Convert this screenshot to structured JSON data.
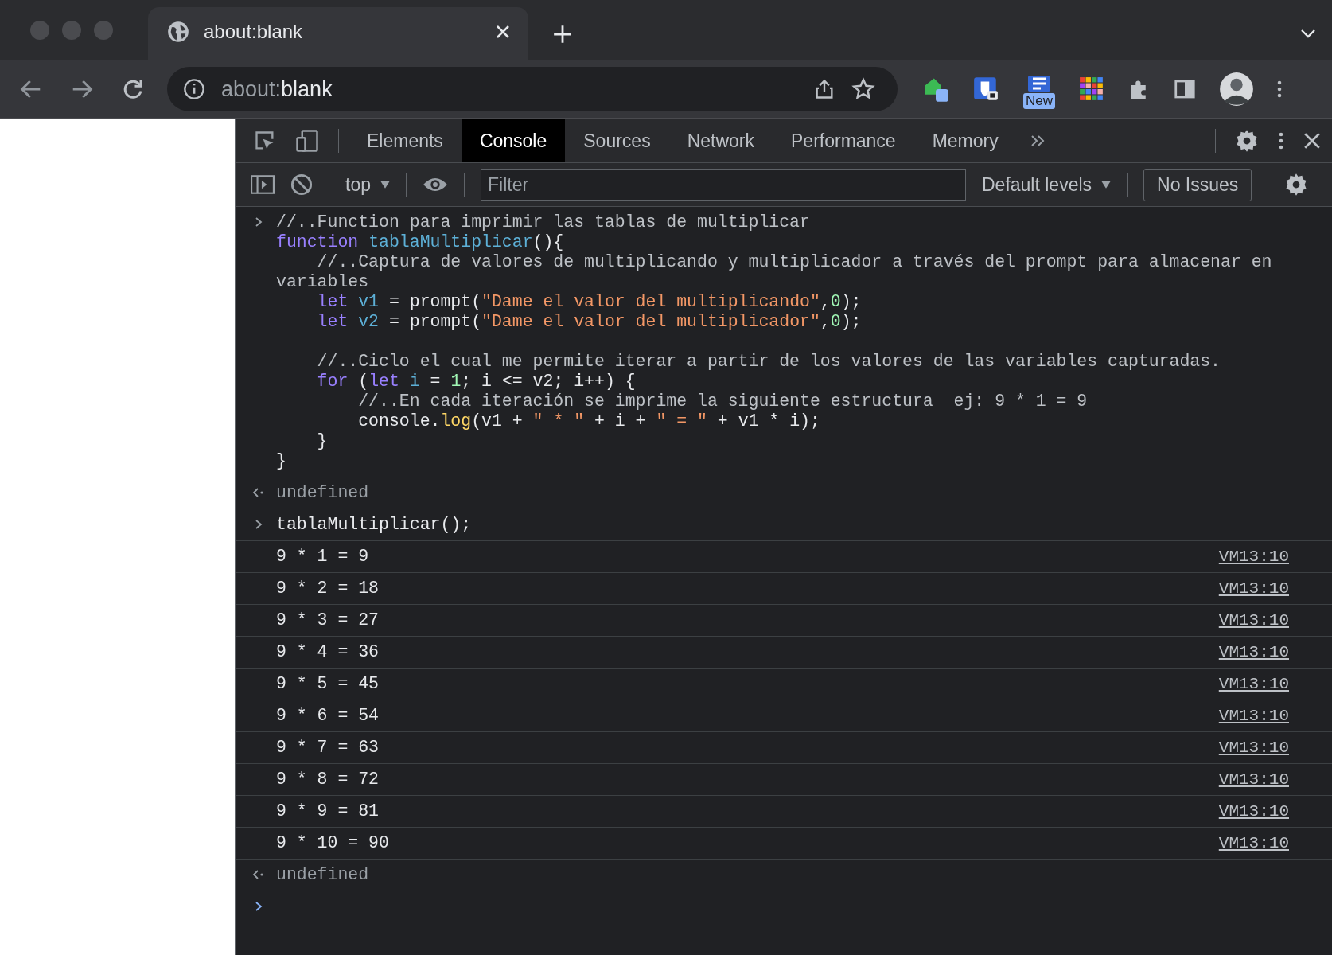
{
  "tabs": [
    {
      "title": "about:blank",
      "selected": true
    }
  ],
  "address_bar": {
    "scheme": "about:",
    "rest": "blank"
  },
  "extensions": [
    {
      "kind": "green"
    },
    {
      "kind": "shield"
    },
    {
      "kind": "new",
      "badge": "New"
    },
    {
      "kind": "grid"
    },
    {
      "kind": "puzzle"
    },
    {
      "kind": "panel"
    },
    {
      "kind": "avatar"
    }
  ],
  "devtools": {
    "tabs": [
      {
        "label": "Elements",
        "selected": false
      },
      {
        "label": "Console",
        "selected": true
      },
      {
        "label": "Sources",
        "selected": false
      },
      {
        "label": "Network",
        "selected": false
      },
      {
        "label": "Performance",
        "selected": false
      },
      {
        "label": "Memory",
        "selected": false
      }
    ],
    "context": "top",
    "filter": {
      "placeholder": "Filter"
    },
    "levels": "Default levels",
    "issues": "No Issues"
  },
  "console": [
    {
      "kind": "input",
      "lines": [
        {
          "kind": "code",
          "tokens": [
            {
              "kind": "comment",
              "text": "//..Function para imprimir las tablas de multiplicar"
            }
          ]
        },
        {
          "kind": "code",
          "tokens": [
            {
              "kind": "keyword",
              "text": "function "
            },
            {
              "kind": "def",
              "text": "tablaMultiplicar"
            },
            {
              "kind": "plain",
              "text": "(){"
            }
          ]
        },
        {
          "kind": "code",
          "tokens": [
            {
              "kind": "comment",
              "text": "    //..Captura de valores de multiplicando y multiplicador a través del prompt para almacenar en variables"
            }
          ]
        },
        {
          "kind": "code",
          "tokens": [
            {
              "kind": "keyword",
              "text": "    let "
            },
            {
              "kind": "def",
              "text": "v1"
            },
            {
              "kind": "plain",
              "text": " = prompt("
            },
            {
              "kind": "string",
              "text": "\"Dame el valor del multiplicando\""
            },
            {
              "kind": "plain",
              "text": ","
            },
            {
              "kind": "number",
              "text": "0"
            },
            {
              "kind": "plain",
              "text": ");"
            }
          ]
        },
        {
          "kind": "code",
          "tokens": [
            {
              "kind": "keyword",
              "text": "    let "
            },
            {
              "kind": "def",
              "text": "v2"
            },
            {
              "kind": "plain",
              "text": " = prompt("
            },
            {
              "kind": "string",
              "text": "\"Dame el valor del multiplicador\""
            },
            {
              "kind": "plain",
              "text": ","
            },
            {
              "kind": "number",
              "text": "0"
            },
            {
              "kind": "plain",
              "text": ");"
            }
          ]
        },
        {
          "kind": "blank"
        },
        {
          "kind": "code",
          "tokens": [
            {
              "kind": "comment",
              "text": "    //..Ciclo el cual me permite iterar a partir de los valores de las variables capturadas."
            }
          ]
        },
        {
          "kind": "code",
          "tokens": [
            {
              "kind": "keyword",
              "text": "    for"
            },
            {
              "kind": "plain",
              "text": " ("
            },
            {
              "kind": "keyword",
              "text": "let "
            },
            {
              "kind": "def",
              "text": "i"
            },
            {
              "kind": "plain",
              "text": " = "
            },
            {
              "kind": "number",
              "text": "1"
            },
            {
              "kind": "plain",
              "text": "; i <= v2; i++) {"
            }
          ]
        },
        {
          "kind": "code",
          "tokens": [
            {
              "kind": "comment",
              "text": "        //..En cada iteración se imprime la siguiente estructura  ej: 9 * 1 = 9"
            }
          ]
        },
        {
          "kind": "code",
          "tokens": [
            {
              "kind": "plain",
              "text": "        console."
            },
            {
              "kind": "method",
              "text": "log"
            },
            {
              "kind": "plain",
              "text": "(v1 + "
            },
            {
              "kind": "string",
              "text": "\" * \""
            },
            {
              "kind": "plain",
              "text": " + i + "
            },
            {
              "kind": "string",
              "text": "\" = \""
            },
            {
              "kind": "plain",
              "text": " + v1 * i);"
            }
          ]
        },
        {
          "kind": "code",
          "tokens": [
            {
              "kind": "plain",
              "text": "    }"
            }
          ]
        },
        {
          "kind": "code",
          "tokens": [
            {
              "kind": "plain",
              "text": "}"
            }
          ]
        }
      ]
    },
    {
      "kind": "return",
      "text": "undefined"
    },
    {
      "kind": "input",
      "lines": [
        {
          "kind": "code",
          "tokens": [
            {
              "kind": "plain",
              "text": "tablaMultiplicar();"
            }
          ]
        }
      ]
    },
    {
      "kind": "log",
      "text": "9 * 1 = 9",
      "source": "VM13:10"
    },
    {
      "kind": "log",
      "text": "9 * 2 = 18",
      "source": "VM13:10"
    },
    {
      "kind": "log",
      "text": "9 * 3 = 27",
      "source": "VM13:10"
    },
    {
      "kind": "log",
      "text": "9 * 4 = 36",
      "source": "VM13:10"
    },
    {
      "kind": "log",
      "text": "9 * 5 = 45",
      "source": "VM13:10"
    },
    {
      "kind": "log",
      "text": "9 * 6 = 54",
      "source": "VM13:10"
    },
    {
      "kind": "log",
      "text": "9 * 7 = 63",
      "source": "VM13:10"
    },
    {
      "kind": "log",
      "text": "9 * 8 = 72",
      "source": "VM13:10"
    },
    {
      "kind": "log",
      "text": "9 * 9 = 81",
      "source": "VM13:10"
    },
    {
      "kind": "log",
      "text": "9 * 10 = 90",
      "source": "VM13:10"
    },
    {
      "kind": "return",
      "text": "undefined"
    },
    {
      "kind": "prompt"
    }
  ]
}
